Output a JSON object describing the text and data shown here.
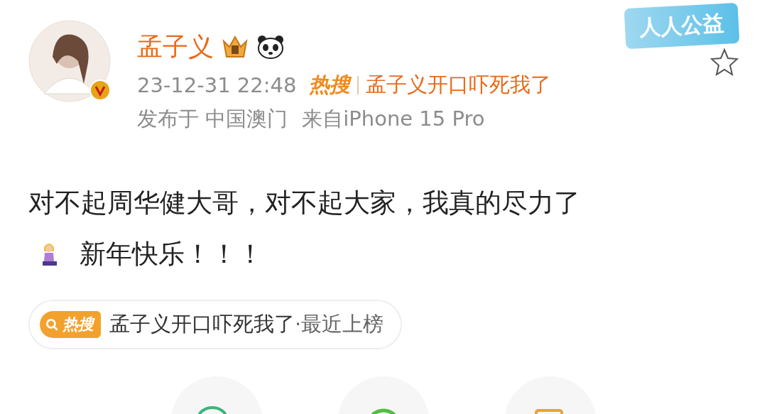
{
  "author": {
    "name": "孟子义",
    "verified": true
  },
  "badge": {
    "text": "人人公益"
  },
  "favorited": false,
  "post_meta": {
    "time": "23-12-31 22:48",
    "hot_label": "热搜",
    "hot_topic": "孟子义开口吓死我了",
    "location": "发布于 中国澳门",
    "source": "来自iPhone 15 Pro"
  },
  "body": {
    "lines": [
      "对不起周华健大哥，对不起大家，我真的尽力了",
      "新年快乐！！！"
    ]
  },
  "hot_search": {
    "label": "热搜",
    "topic": "孟子义开口吓死我了",
    "suffix": "·最近上榜"
  },
  "share": [
    {
      "kind": "wechat"
    },
    {
      "kind": "moments"
    },
    {
      "kind": "save-image"
    }
  ]
}
